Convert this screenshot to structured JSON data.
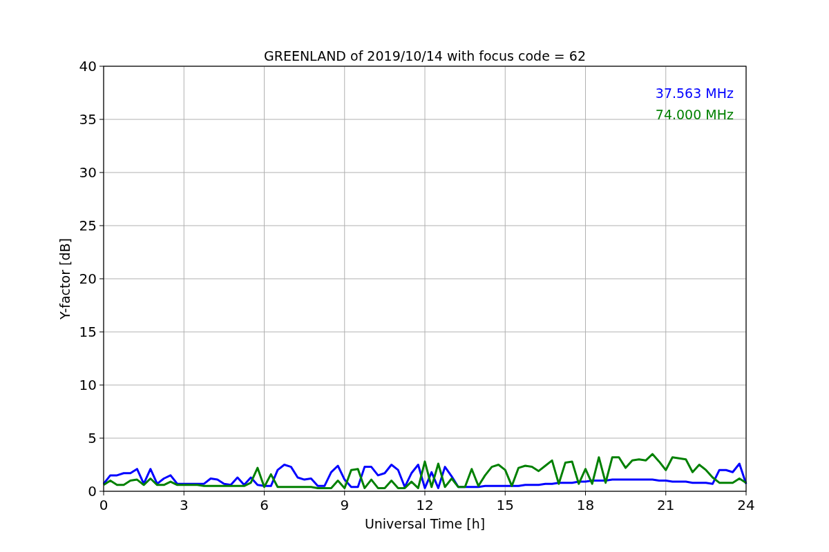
{
  "chart_data": {
    "type": "line",
    "title": "GREENLAND of 2019/10/14 with focus code = 62",
    "xlabel": "Universal Time [h]",
    "ylabel": "Y-factor [dB]",
    "grid": true,
    "xlim": [
      0,
      24
    ],
    "ylim": [
      0,
      40
    ],
    "xticks": [
      0,
      3,
      6,
      9,
      12,
      15,
      18,
      21,
      24
    ],
    "yticks": [
      0,
      5,
      10,
      15,
      20,
      25,
      30,
      35,
      40
    ],
    "x": [
      0,
      0.25,
      0.5,
      0.75,
      1,
      1.25,
      1.5,
      1.75,
      2,
      2.25,
      2.5,
      2.75,
      3,
      3.25,
      3.5,
      3.75,
      4,
      4.25,
      4.5,
      4.75,
      5,
      5.25,
      5.5,
      5.75,
      6,
      6.25,
      6.5,
      6.75,
      7,
      7.25,
      7.5,
      7.75,
      8,
      8.25,
      8.5,
      8.75,
      9,
      9.25,
      9.5,
      9.75,
      10,
      10.25,
      10.5,
      10.75,
      11,
      11.25,
      11.5,
      11.75,
      12,
      12.25,
      12.5,
      12.75,
      13,
      13.25,
      13.5,
      13.75,
      14,
      14.25,
      14.5,
      14.75,
      15,
      15.25,
      15.5,
      15.75,
      16,
      16.25,
      16.5,
      16.75,
      17,
      17.25,
      17.5,
      17.75,
      18,
      18.25,
      18.5,
      18.75,
      19,
      19.25,
      19.5,
      19.75,
      20,
      20.25,
      20.5,
      20.75,
      21,
      21.25,
      21.5,
      21.75,
      22,
      22.25,
      22.5,
      22.75,
      23,
      23.25,
      23.5,
      23.75,
      24
    ],
    "series": [
      {
        "name": "37.563 MHz",
        "color": "#0000ff",
        "values": [
          0.7,
          1.5,
          1.5,
          1.7,
          1.7,
          2.1,
          0.7,
          2.1,
          0.7,
          1.2,
          1.5,
          0.7,
          0.7,
          0.7,
          0.7,
          0.7,
          1.2,
          1.1,
          0.7,
          0.6,
          1.3,
          0.6,
          1.3,
          0.6,
          0.5,
          0.5,
          2.0,
          2.5,
          2.3,
          1.3,
          1.1,
          1.2,
          0.5,
          0.5,
          1.8,
          2.4,
          1.1,
          0.4,
          0.4,
          2.3,
          2.3,
          1.5,
          1.7,
          2.5,
          2.0,
          0.4,
          1.7,
          2.5,
          0.3,
          1.8,
          0.3,
          2.3,
          1.4,
          0.4,
          0.4,
          0.4,
          0.4,
          0.5,
          0.5,
          0.5,
          0.5,
          0.5,
          0.5,
          0.6,
          0.6,
          0.6,
          0.7,
          0.7,
          0.8,
          0.8,
          0.8,
          0.9,
          0.9,
          1.0,
          1.0,
          1.0,
          1.1,
          1.1,
          1.1,
          1.1,
          1.1,
          1.1,
          1.1,
          1.0,
          1.0,
          0.9,
          0.9,
          0.9,
          0.8,
          0.8,
          0.8,
          0.7,
          2.0,
          2.0,
          1.8,
          2.6,
          0.7
        ]
      },
      {
        "name": "74.000 MHz",
        "color": "#008000",
        "values": [
          0.6,
          1.0,
          0.6,
          0.6,
          1.0,
          1.1,
          0.6,
          1.2,
          0.6,
          0.6,
          0.9,
          0.6,
          0.6,
          0.6,
          0.6,
          0.5,
          0.5,
          0.5,
          0.5,
          0.5,
          0.5,
          0.5,
          0.8,
          2.2,
          0.4,
          1.6,
          0.4,
          0.4,
          0.4,
          0.4,
          0.4,
          0.4,
          0.3,
          0.3,
          0.3,
          1.0,
          0.3,
          2.0,
          2.1,
          0.3,
          1.1,
          0.3,
          0.3,
          1.0,
          0.3,
          0.3,
          0.9,
          0.3,
          2.8,
          0.4,
          2.6,
          0.4,
          1.2,
          0.4,
          0.4,
          2.1,
          0.5,
          1.5,
          2.3,
          2.5,
          2.0,
          0.5,
          2.2,
          2.4,
          2.3,
          1.9,
          2.4,
          2.9,
          0.7,
          2.7,
          2.8,
          0.7,
          2.1,
          0.7,
          3.2,
          0.8,
          3.2,
          3.2,
          2.2,
          2.9,
          3.0,
          2.9,
          3.5,
          2.8,
          2.0,
          3.2,
          3.1,
          3.0,
          1.8,
          2.5,
          2.0,
          1.3,
          0.8,
          0.8,
          0.8,
          1.2,
          0.8
        ]
      }
    ]
  }
}
